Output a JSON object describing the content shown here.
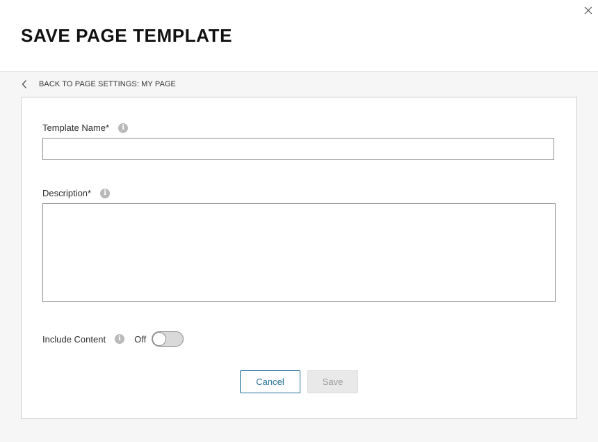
{
  "header": {
    "title": "SAVE PAGE TEMPLATE",
    "close_icon": "close-icon"
  },
  "back_link": {
    "label": "BACK TO PAGE SETTINGS: MY PAGE",
    "icon": "chevron-left-icon"
  },
  "form": {
    "template_name": {
      "label": "Template Name*",
      "value": "",
      "placeholder": "",
      "info_icon": "info-icon"
    },
    "description": {
      "label": "Description*",
      "value": "",
      "placeholder": "",
      "info_icon": "info-icon"
    },
    "include_content": {
      "label": "Include Content",
      "state_label": "Off",
      "enabled": false,
      "info_icon": "info-icon"
    }
  },
  "actions": {
    "cancel_label": "Cancel",
    "save_label": "Save",
    "save_disabled": true
  },
  "colors": {
    "accent": "#1f6e98",
    "disabled_bg": "#e9e9e9",
    "disabled_text": "#9a9a9a",
    "page_bg": "#f6f6f6"
  }
}
